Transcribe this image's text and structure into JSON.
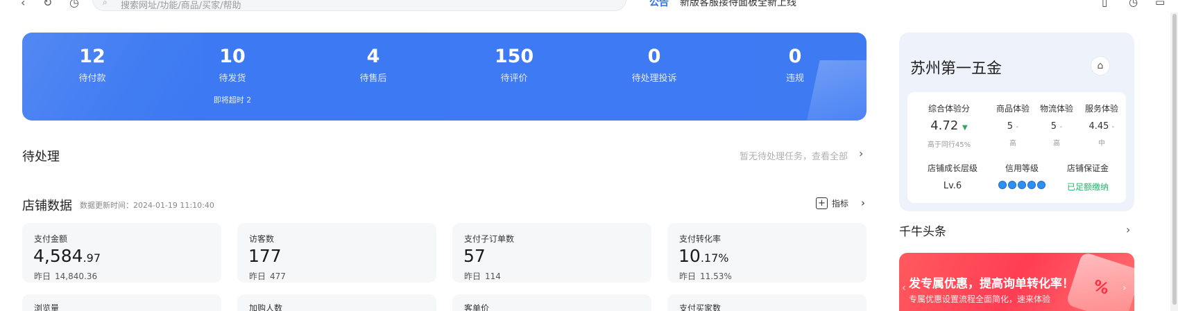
{
  "topbar": {
    "back_icon": "back-arrow-icon",
    "refresh_icon": "refresh-icon",
    "history_icon": "history-icon",
    "search_placeholder": "搜索网址/功能/商品/买家/帮助",
    "notice_tag": "公告",
    "notice_text": "新版客服接待面板全新上线"
  },
  "banner": {
    "stats": [
      {
        "value": "12",
        "label": "待付款"
      },
      {
        "value": "10",
        "label": "待发货",
        "sub": "即将超时 2"
      },
      {
        "value": "4",
        "label": "待售后"
      },
      {
        "value": "150",
        "label": "待评价"
      },
      {
        "value": "0",
        "label": "待处理投诉"
      },
      {
        "value": "0",
        "label": "违规"
      }
    ]
  },
  "pending": {
    "title": "待处理",
    "link": "暂无待处理任务，查看全部",
    "arrow": "›"
  },
  "store_data": {
    "title": "店铺数据",
    "update_time": "数据更新时间：2024-01-19 11:10:40",
    "metrics_button": "指标",
    "metrics_arrow": "›",
    "yesterday_label": "昨日",
    "cards": [
      {
        "label": "支付金额",
        "value_int": "4,584",
        "value_dec": ".97",
        "yesterday": "14,840.36"
      },
      {
        "label": "访客数",
        "value_int": "177",
        "value_dec": "",
        "yesterday": "477"
      },
      {
        "label": "支付子订单数",
        "value_int": "57",
        "value_dec": "",
        "yesterday": "114"
      },
      {
        "label": "支付转化率",
        "value_int": "10",
        "value_dec": ".17%",
        "yesterday": "11.53%"
      }
    ],
    "cards_row2": [
      {
        "label": "浏览量"
      },
      {
        "label": "加购人数"
      },
      {
        "label": "客单价"
      },
      {
        "label": "支付买家数"
      }
    ]
  },
  "shop": {
    "name": "苏州第一五金",
    "icon": "shop-icon",
    "scores": {
      "overall_label": "综合体验分",
      "overall_value": "4.72",
      "overall_trend": "▼",
      "overall_footer": "高于同行45%",
      "product_label": "商品体验",
      "product_value": "5",
      "product_footer": "高",
      "logistics_label": "物流体验",
      "logistics_value": "5",
      "logistics_footer": "高",
      "service_label": "服务体验",
      "service_value": "4.45",
      "service_footer": "中",
      "dash": "-"
    },
    "growth_label": "店铺成长层级",
    "growth_value": "Lv.6",
    "credit_label": "信用等级",
    "credit_level": 5,
    "deposit_label": "店铺保证金",
    "deposit_value": "已足额缴纳"
  },
  "news": {
    "title": "千牛头条",
    "arrow": "›"
  },
  "promo": {
    "title": "发专属优惠，提高询单转化率！",
    "subtitle": "专属优惠设置流程全面简化，速来体验",
    "percent": "%"
  },
  "colors": {
    "banner_blue": "#3b78f2",
    "accent_blue": "#2f6ff0",
    "green": "#27b36a",
    "promo_red": "#ff3d53"
  }
}
